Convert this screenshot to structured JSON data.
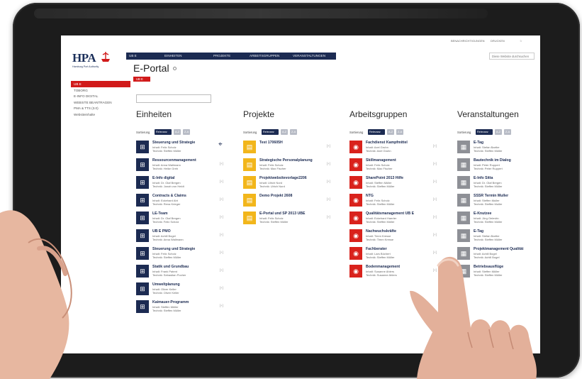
{
  "util": {
    "notes": "BENACHRICHTIGUNGEN",
    "print": "DRUCKEN",
    "bookmark": "☆"
  },
  "logo": {
    "mark": "HPA",
    "subtitle": "Hamburg Port Authority"
  },
  "navbar": [
    "UB E",
    "EINHEITEN",
    "PROJEKTE",
    "ARBEITSGRUPPEN",
    "VERANSTALTUNGEN"
  ],
  "site_search": {
    "placeholder": "Diese Website durchsuchen"
  },
  "page": {
    "title": "E-Portal",
    "badge": "UB E"
  },
  "leftnav": [
    "UB E",
    "TOBORG",
    "E-INFO DIGITAL",
    "WEBSITE BEANTRAGEN",
    "PMA & TTS (3.0)",
    "Websiteinhalte"
  ],
  "sort": {
    "label": "Sortierung",
    "relevanz": "Relevanz",
    "az": "A-Z",
    "za": "Z-A"
  },
  "join_label": "[+]",
  "columns": [
    {
      "title": "Einheiten",
      "items": [
        {
          "title": "Steuerung und Strategie",
          "m1": "Inhalt: Felix Scholz",
          "m2": "Technik: Steffen Müller"
        },
        {
          "title": "Ressourcenmanagement",
          "m1": "Inhalt: Anna Wallmann",
          "m2": "Technik: Heike Greb"
        },
        {
          "title": "E-Info digital",
          "m1": "Inhalt: Dr. Olaf Bergen",
          "m2": "Technik: Jonah von Heldt"
        },
        {
          "title": "Contracts & Claims",
          "m1": "Inhalt: Eckehard Abt",
          "m2": "Technik: Rena Krieger"
        },
        {
          "title": "LE-Team",
          "m1": "Inhalt: Dr. Olaf Bergen",
          "m2": "Technik: Felix Scholz"
        },
        {
          "title": "UB E PMO",
          "m1": "Inhalt: Achill Bogel",
          "m2": "Technik: Anna Wallmann"
        },
        {
          "title": "Steuerung und Strategie",
          "m1": "Inhalt: Felix Scholz",
          "m2": "Technik: Steffen Müller"
        },
        {
          "title": "Statik und Grundbau",
          "m1": "Inhalt: Frank Patent",
          "m2": "Technik: Sebastian Pocher"
        },
        {
          "title": "Umweltplanung",
          "m1": "Inhalt: Oliver Keller",
          "m2": "Technik: Oliver Keller"
        },
        {
          "title": "Kaimauer-Programm",
          "m1": "Inhalt: Steffen Müller",
          "m2": "Technik: Steffen Müller"
        }
      ]
    },
    {
      "title": "Projekte",
      "items": [
        {
          "title": "Test 170605H",
          "m1": "",
          "m2": ""
        },
        {
          "title": "Strategische Personalplanung",
          "m1": "Inhalt: Felix Scholz",
          "m2": "Technik: Max Fischer"
        },
        {
          "title": "Projektwebsitevorlage2206",
          "m1": "Inhalt: Ulrich Nord",
          "m2": "Technik: Ulrich Nord"
        },
        {
          "title": "Demo Projekt 2608",
          "m1": "",
          "m2": ""
        },
        {
          "title": "E-Portal und SP 2013 UBE",
          "m1": "Inhalt: Felix Scholz",
          "m2": "Technik: Steffen Müller"
        }
      ]
    },
    {
      "title": "Arbeitsgruppen",
      "items": [
        {
          "title": "Fachdienst Kampfmittel",
          "m1": "Inhalt: Axel Gruhn",
          "m2": "Technik: Axel Gruhn"
        },
        {
          "title": "Skillmanagement",
          "m1": "Inhalt: Felix Scholz",
          "m2": "Technik: Max Fischer"
        },
        {
          "title": "SharePoint 2013 Hilfe",
          "m1": "Inhalt: Steffen Müller",
          "m2": "Technik: Steffen Müller"
        },
        {
          "title": "NTG",
          "m1": "Inhalt: Felix Scholz",
          "m2": "Technik: Steffen Müller"
        },
        {
          "title": "Qualitätsmanagement UB E",
          "m1": "Inhalt: Eckehard Haerter",
          "m2": "Technik: Steffen Müller"
        },
        {
          "title": "Nachwuchskräfte",
          "m1": "Inhalt: Timm Kresse",
          "m2": "Technik: Timm Kresse"
        },
        {
          "title": "Fachberater",
          "m1": "Inhalt: Lars Büchert",
          "m2": "Technik: Steffen Müller"
        },
        {
          "title": "Bodenmanagement",
          "m1": "Inhalt: Susanne Ahlers",
          "m2": "Technik: Susanne Ahlers"
        }
      ]
    },
    {
      "title": "Veranstaltungen",
      "items": [
        {
          "title": "E-Tag",
          "m1": "Inhalt: Stefan Barthe",
          "m2": "Technik: Steffen Müller"
        },
        {
          "title": "Bautechnik im Dialog",
          "m1": "Inhalt: Peter Ruppert",
          "m2": "Technik: Peter Ruppert"
        },
        {
          "title": "E-Info Sitta",
          "m1": "Inhalt: Dr. Olaf Bergen",
          "m2": "Technik: Steffen Müller"
        },
        {
          "title": "SSSR Termin Muller",
          "m1": "Inhalt: Steffen Muller",
          "m2": "Technik: Steffen Muller"
        },
        {
          "title": "E-Knutzee",
          "m1": "Inhalt: Jörg Oelevtin",
          "m2": "Technik: Steffen Müller"
        },
        {
          "title": "E-Tag",
          "m1": "Inhalt: Stefan Barthe",
          "m2": "Technik: Steffen Müller"
        },
        {
          "title": "Projektmanagement Qualität",
          "m1": "Inhalt: Achill Bogel",
          "m2": "Technik: Achill Bogel"
        },
        {
          "title": "Betriebsausflüge",
          "m1": "Inhalt: Steffen Müller",
          "m2": "Technik: Steffen Müller"
        }
      ]
    }
  ]
}
